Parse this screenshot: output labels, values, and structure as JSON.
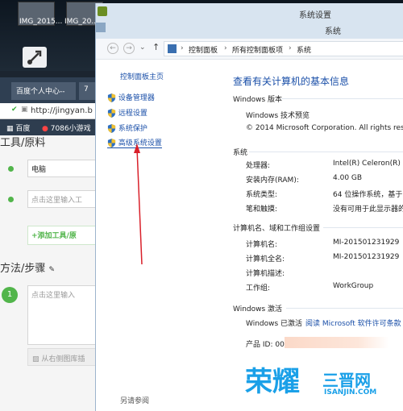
{
  "desktop": {
    "icons": [
      {
        "label": "IMG_2015..."
      },
      {
        "label": "IMG_20..."
      }
    ]
  },
  "browser": {
    "tabs": [
      {
        "label": "百度个人中心--"
      },
      {
        "label": "7"
      }
    ],
    "address": "http://jingyan.b",
    "favorites": [
      {
        "label": "百度"
      },
      {
        "label": "7086小游戏"
      }
    ],
    "heading_tools": "工具/原料",
    "tool_value": "电脑",
    "tool_placeholder": "点击这里输入工",
    "add_tool_btn": "+添加工具/原",
    "heading_steps": "方法/步骤",
    "step_number": "1",
    "step_placeholder": "点击这里输入",
    "upload_hint": "从右侧图库插"
  },
  "window": {
    "outer_title": "系统设置",
    "title": "系统",
    "breadcrumb": [
      "控制面板",
      "所有控制面板项",
      "系统"
    ],
    "left": {
      "home": "控制面板主页",
      "links": [
        {
          "label": "设备管理器"
        },
        {
          "label": "远程设置"
        },
        {
          "label": "系统保护"
        },
        {
          "label": "高级系统设置"
        }
      ],
      "see_also": "另请参阅"
    },
    "main": {
      "heading": "查看有关计算机的基本信息",
      "edition_title": "Windows 版本",
      "edition_name": "Windows 技术预览",
      "copyright": "© 2014 Microsoft Corporation. All rights rese",
      "system_title": "系统",
      "system_rows": [
        {
          "k": "处理器:",
          "v": "Intel(R) Celeron(R) C"
        },
        {
          "k": "安装内存(RAM):",
          "v": "4.00 GB"
        },
        {
          "k": "系统类型:",
          "v": "64 位操作系统，基于"
        },
        {
          "k": "笔和触摸:",
          "v": "没有可用于此显示器的"
        }
      ],
      "computer_title": "计算机名、域和工作组设置",
      "computer_rows": [
        {
          "k": "计算机名:",
          "v": "MI-201501231929"
        },
        {
          "k": "计算机全名:",
          "v": "MI-201501231929"
        },
        {
          "k": "计算机描述:",
          "v": ""
        },
        {
          "k": "工作组:",
          "v": "WorkGroup"
        }
      ],
      "activation_title": "Windows 激活",
      "activation_status": "Windows 已激活",
      "activation_link": "阅读 Microsoft 软件许可条款",
      "product_id_label": "产品 ID: 00"
    }
  },
  "watermark": {
    "brand": "荣耀",
    "sub": "三晋网",
    "url": "ISANJIN.COM"
  },
  "colors": {
    "link": "#1a4fa8",
    "accent_green": "#52b54b",
    "arrow": "#d9202a",
    "watermark_blue": "#1aa0e8"
  }
}
